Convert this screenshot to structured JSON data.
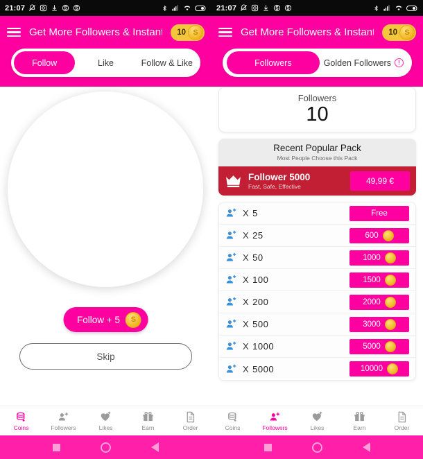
{
  "status_bar": {
    "time": "21:07",
    "left_icons": [
      "bell-off-icon",
      "screen-record-icon",
      "download-icon",
      "circled-s-icon",
      "circled-s-icon"
    ],
    "right_icons": [
      "bluetooth-icon",
      "signal-icon",
      "wifi-icon",
      "battery-icon"
    ]
  },
  "app": {
    "title": "Get More Followers & Instant L...",
    "coins": "10",
    "menu_icon": "hamburger-icon",
    "coin_icon": "coin-icon",
    "accent_color": "#ff00a0",
    "coin_color": "#f5c63c"
  },
  "left_panel": {
    "tabs": [
      {
        "label": "Follow",
        "active": true
      },
      {
        "label": "Like",
        "active": false
      },
      {
        "label": "Follow & Like",
        "active": false
      }
    ],
    "avatar_placeholder": "profile-avatar-placeholder",
    "follow_button": {
      "label": "Follow + 5",
      "coin_icon": "coin-icon"
    },
    "skip_button": {
      "label": "Skip"
    }
  },
  "right_panel": {
    "tabs": [
      {
        "label": "Followers",
        "active": true,
        "info": ""
      },
      {
        "label": "Golden Followers",
        "active": false,
        "info": "!"
      }
    ],
    "counter": {
      "label": "Followers",
      "value": "10"
    },
    "popular_pack": {
      "title": "Recent Popular Pack",
      "subtitle": "Most People Choose this Pack",
      "crown_icon": "crown-icon",
      "name": "Follower 5000",
      "description": "Fast, Safe, Effective",
      "price": "49,99 €",
      "banner_color": "#c21f35"
    },
    "packs": [
      {
        "icon": "person-add-icon",
        "multiplier": "X",
        "amount": "5",
        "price": "Free",
        "has_coin": false
      },
      {
        "icon": "person-add-icon",
        "multiplier": "X",
        "amount": "25",
        "price": "600",
        "has_coin": true
      },
      {
        "icon": "person-add-icon",
        "multiplier": "X",
        "amount": "50",
        "price": "1000",
        "has_coin": true
      },
      {
        "icon": "person-add-icon",
        "multiplier": "X",
        "amount": "100",
        "price": "1500",
        "has_coin": true
      },
      {
        "icon": "person-add-icon",
        "multiplier": "X",
        "amount": "200",
        "price": "2000",
        "has_coin": true
      },
      {
        "icon": "person-add-icon",
        "multiplier": "X",
        "amount": "500",
        "price": "3000",
        "has_coin": true
      },
      {
        "icon": "person-add-icon",
        "multiplier": "X",
        "amount": "1000",
        "price": "5000",
        "has_coin": true
      },
      {
        "icon": "person-add-icon",
        "multiplier": "X",
        "amount": "5000",
        "price": "10000",
        "has_coin": true
      }
    ]
  },
  "bottom_nav_left": [
    {
      "label": "Coins",
      "icon": "coins-stack-icon",
      "active": true
    },
    {
      "label": "Followers",
      "icon": "person-add-icon",
      "active": false
    },
    {
      "label": "Likes",
      "icon": "heart-plus-icon",
      "active": false
    },
    {
      "label": "Earn",
      "icon": "gift-icon",
      "active": false
    },
    {
      "label": "Order",
      "icon": "document-icon",
      "active": false
    }
  ],
  "bottom_nav_right": [
    {
      "label": "Coins",
      "icon": "coins-stack-icon",
      "active": false
    },
    {
      "label": "Followers",
      "icon": "person-add-icon",
      "active": true
    },
    {
      "label": "Likes",
      "icon": "heart-plus-icon",
      "active": false
    },
    {
      "label": "Earn",
      "icon": "gift-icon",
      "active": false
    },
    {
      "label": "Order",
      "icon": "document-icon",
      "active": false
    }
  ],
  "system_nav": {
    "recents_icon": "square-recents-icon",
    "home_icon": "circle-home-icon",
    "back_icon": "triangle-back-icon"
  }
}
